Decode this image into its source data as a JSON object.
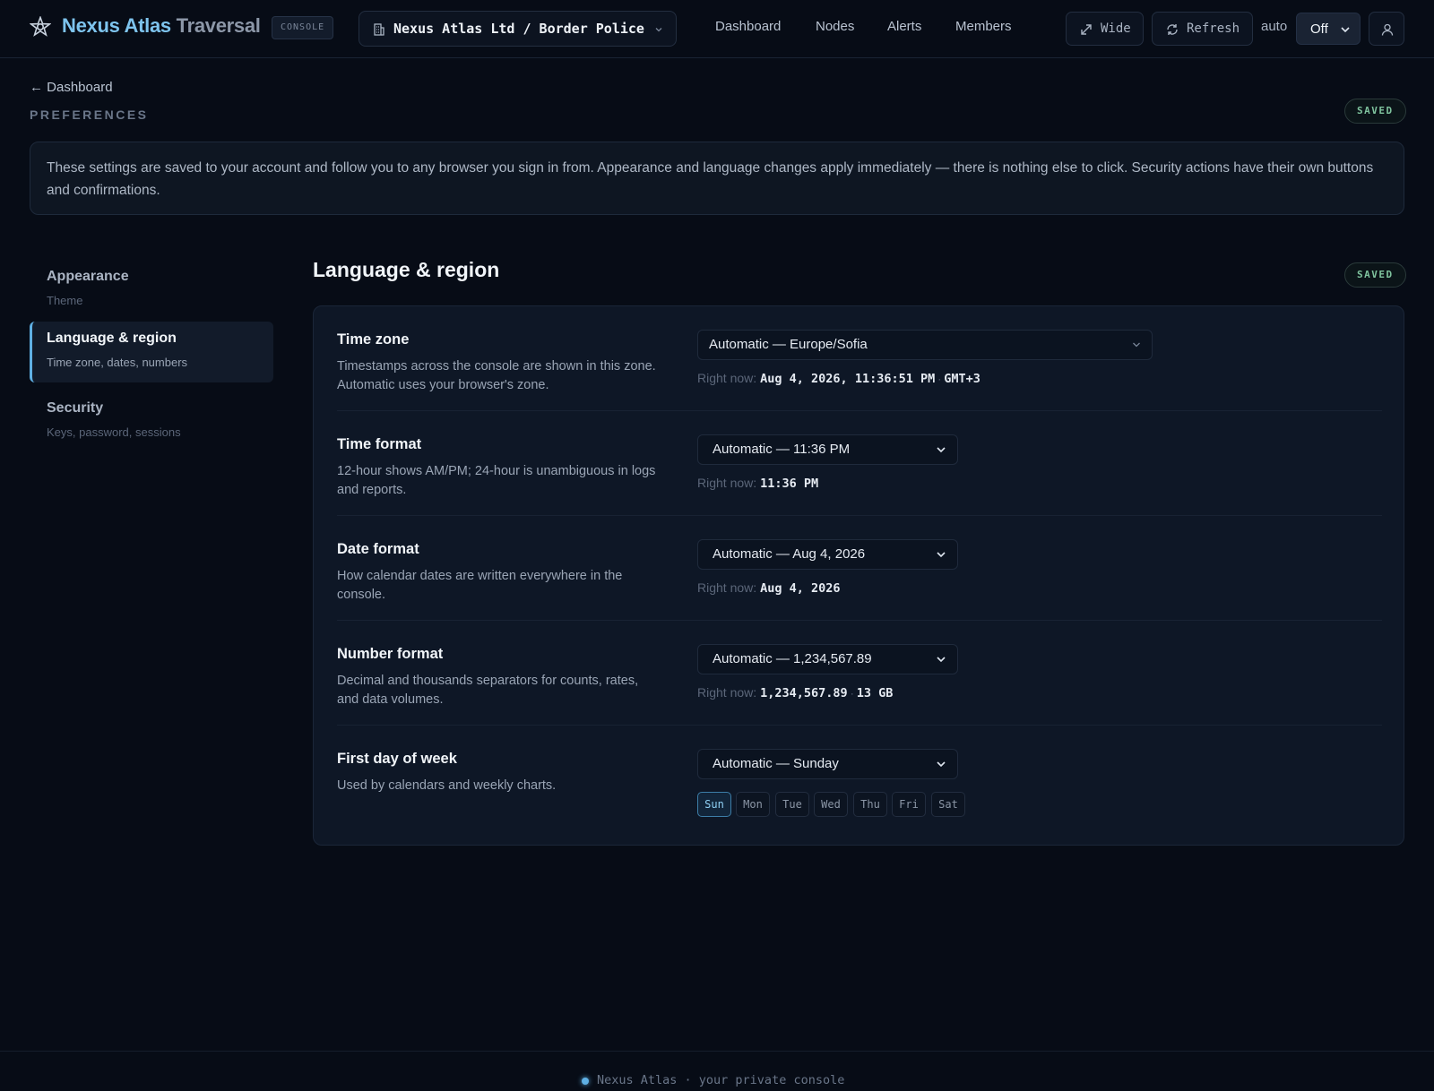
{
  "header": {
    "brand_primary": "Nexus Atlas",
    "brand_secondary": "Traversal",
    "console_badge": "CONSOLE",
    "org_selector": "Nexus Atlas Ltd / Border Police",
    "nav": [
      "Dashboard",
      "Nodes",
      "Alerts",
      "Members"
    ],
    "wide_label": "Wide",
    "refresh_label": "Refresh",
    "auto_label": "auto",
    "auto_value": "Off"
  },
  "page": {
    "back_label": "← Dashboard",
    "eyebrow": "PREFERENCES",
    "saved_badge": "SAVED",
    "info": "These settings are saved to your account and follow you to any browser you sign in from. Appearance and language changes apply immediately — there is nothing else to click. Security actions have their own buttons and confirmations."
  },
  "sidebar": {
    "items": [
      {
        "title": "Appearance",
        "subtitle": "Theme"
      },
      {
        "title": "Language & region",
        "subtitle": "Time zone, dates, numbers"
      },
      {
        "title": "Security",
        "subtitle": "Keys, password, sessions"
      }
    ]
  },
  "section": {
    "title": "Language & region",
    "saved_badge": "SAVED",
    "right_now_label": "Right now:",
    "rows": [
      {
        "label": "Time zone",
        "desc": "Timestamps across the console are shown in this zone. Automatic uses your browser's zone.",
        "select": "Automatic — Europe/Sofia",
        "now_value": "Aug 4, 2026, 11:36:51 PM",
        "now_extra": "GMT+3"
      },
      {
        "label": "Time format",
        "desc": "12-hour shows AM/PM; 24-hour is unambiguous in logs and reports.",
        "select": "Automatic — 11:36 PM",
        "now_value": "11:36 PM"
      },
      {
        "label": "Date format",
        "desc": "How calendar dates are written everywhere in the console.",
        "select": "Automatic — Aug 4, 2026",
        "now_value": "Aug 4, 2026"
      },
      {
        "label": "Number format",
        "desc": "Decimal and thousands separators for counts, rates, and data volumes.",
        "select": "Automatic — 1,234,567.89",
        "now_value": "1,234,567.89",
        "now_extra": "13 GB"
      },
      {
        "label": "First day of week",
        "desc": "Used by calendars and weekly charts.",
        "select": "Automatic — Sunday",
        "days": [
          "Sun",
          "Mon",
          "Tue",
          "Wed",
          "Thu",
          "Fri",
          "Sat"
        ],
        "selected_day": "Sun"
      }
    ]
  },
  "footer": {
    "text": "Nexus Atlas · your private console"
  },
  "colors": {
    "background": "#070c16",
    "accent": "#5fb0e4",
    "saved": "#7fc39e"
  }
}
